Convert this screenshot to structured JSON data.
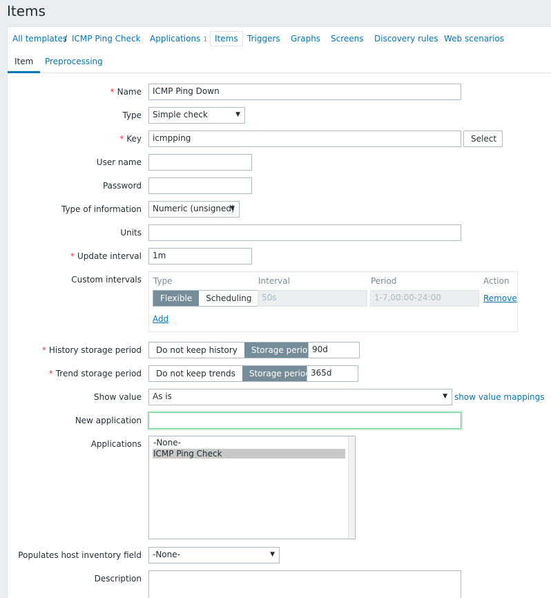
{
  "page": {
    "title": "Items"
  },
  "breadcrumb": {
    "all_templates": "All templates",
    "separator": "/",
    "template": "ICMP Ping Check"
  },
  "nav": {
    "applications": "Applications",
    "applications_count": "1",
    "items": "Items",
    "triggers": "Triggers",
    "graphs": "Graphs",
    "screens": "Screens",
    "discovery_rules": "Discovery rules",
    "web_scenarios": "Web scenarios"
  },
  "tabs": {
    "item": "Item",
    "preprocessing": "Preprocessing"
  },
  "form": {
    "name": {
      "label": "Name",
      "value": "ICMP Ping Down",
      "required": "*"
    },
    "type": {
      "label": "Type",
      "value": "Simple check"
    },
    "key": {
      "label": "Key",
      "value": "icmpping",
      "required": "*",
      "select_label": "Select"
    },
    "user_name": {
      "label": "User name",
      "value": ""
    },
    "password": {
      "label": "Password",
      "value": ""
    },
    "type_of_information": {
      "label": "Type of information",
      "value": "Numeric (unsigned)"
    },
    "units": {
      "label": "Units",
      "value": ""
    },
    "update_interval": {
      "label": "Update interval",
      "value": "1m",
      "required": "*"
    },
    "custom_intervals": {
      "label": "Custom intervals",
      "col_type": "Type",
      "col_interval": "Interval",
      "col_period": "Period",
      "col_action": "Action",
      "flexible": "Flexible",
      "scheduling": "Scheduling",
      "interval_placeholder": "50s",
      "period_placeholder": "1-7,00:00-24:00",
      "remove": "Remove",
      "add": "Add"
    },
    "history": {
      "label": "History storage period",
      "required": "*",
      "do_not_keep": "Do not keep history",
      "storage_period": "Storage period",
      "value": "90d"
    },
    "trend": {
      "label": "Trend storage period",
      "required": "*",
      "do_not_keep": "Do not keep trends",
      "storage_period": "Storage period",
      "value": "365d"
    },
    "show_value": {
      "label": "Show value",
      "value": "As is",
      "mappings_link": "show value mappings"
    },
    "new_application": {
      "label": "New application",
      "value": ""
    },
    "applications": {
      "label": "Applications",
      "options": [
        "-None-",
        "ICMP Ping Check"
      ],
      "selected": "ICMP Ping Check"
    },
    "inventory": {
      "label": "Populates host inventory field",
      "value": "-None-"
    },
    "description": {
      "label": "Description",
      "value": ""
    }
  }
}
